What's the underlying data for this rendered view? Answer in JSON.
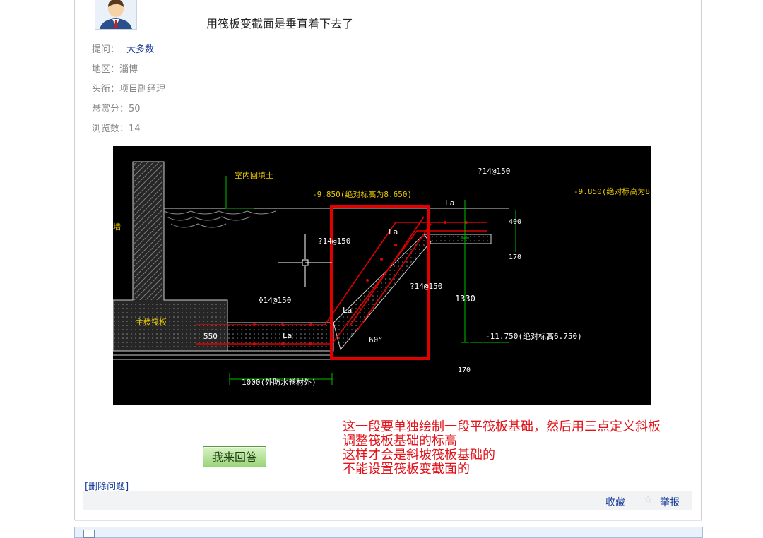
{
  "question": {
    "title": "用筏板变截面是垂直着下去了",
    "meta": {
      "asker_label": "提问：",
      "asker_value": "大多数",
      "region_label": "地区：",
      "region_value": "淄博",
      "title_label": "头衔：",
      "title_value": "项目副经理",
      "reward_label": "悬赏分：",
      "reward_value": "50",
      "views_label": "浏览数：",
      "views_value": "14"
    }
  },
  "drawing": {
    "labels": {
      "indoor_backfill": "室内回填土",
      "elev_top": "-9.850(绝对标高为8.650)",
      "elev_right": "-9.850(绝对标高为8.6",
      "rebar_top_right": "?14@150",
      "rebar_left": "?14@150",
      "rebar_mid": "?14@150",
      "rebar_bottom": "Φ14@150",
      "la_top": "La",
      "la_slope_top": "La",
      "la_slope_bottom": "La",
      "la_bottom": "La",
      "dim_400": "400",
      "dim_170_top": "170",
      "dim_1330": "1330",
      "dim_170_bottom": "170",
      "elev_bottom": "-11.750(绝对标高6.750)",
      "dim_550": "550",
      "dim_1000": "1000(外防水卷材外)",
      "angle": "60°",
      "main_raft": "主楼筏板",
      "wall": "墙"
    },
    "colors": {
      "highlight_box": "#e00000",
      "rebar": "#e00000",
      "label_yellow": "#e8c800",
      "dim_green": "#00c000"
    }
  },
  "note": {
    "line1": "这一段要单独绘制一段平筏板基础，然后用三点定义斜板",
    "line2": "调整筏板基础的标高",
    "line3": "这样才会是斜坡筏板基础的",
    "line4": "不能设置筏板变截面的"
  },
  "actions": {
    "answer_button": "我来回答",
    "delete_link": "[删除问题]",
    "collect_link": "收藏",
    "report_link": "举报"
  },
  "icons": {
    "avatar": "user-avatar-icon",
    "star": "star-icon"
  }
}
